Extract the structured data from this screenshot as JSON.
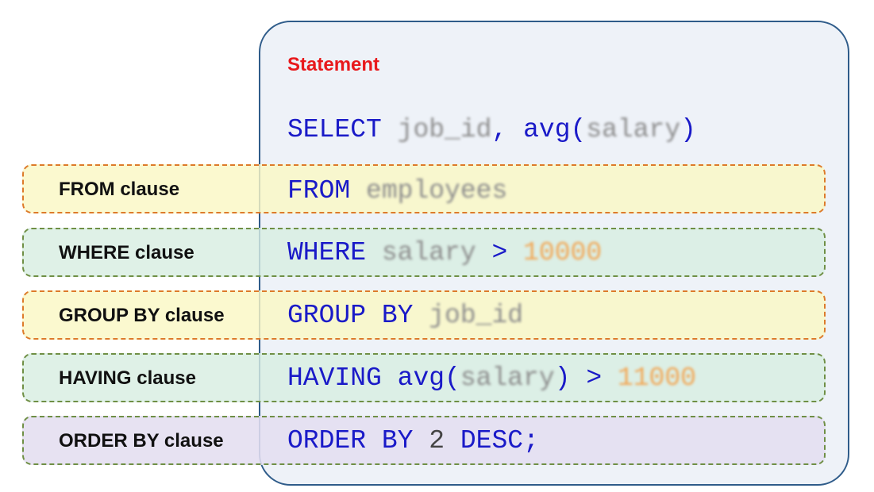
{
  "statement": {
    "title": "Statement"
  },
  "clauses": [
    {
      "label": "FROM clause",
      "color": "#f7f4c0",
      "border_color": "#dd7b2a"
    },
    {
      "label": "WHERE clause",
      "color": "#d8eee2",
      "border_color": "#6f8f45"
    },
    {
      "label": "GROUP BY clause",
      "color": "#f7f4c0",
      "border_color": "#dd7b2a"
    },
    {
      "label": "HAVING clause",
      "color": "#d8eee2",
      "border_color": "#6f8f45"
    },
    {
      "label": "ORDER BY clause",
      "color": "#e4def0",
      "border_color": "#6f8f45"
    }
  ],
  "code": {
    "select_kw": "SELECT",
    "select_col": "job_id",
    "select_comma": ",",
    "select_fn": "avg(",
    "select_arg": "salary",
    "select_close": ")",
    "from_kw": "FROM",
    "from_table": "employees",
    "where_kw": "WHERE",
    "where_col": "salary",
    "where_op": ">",
    "where_value": "10000",
    "group_kw": "GROUP BY",
    "group_col": "job_id",
    "having_kw": "HAVING",
    "having_fn": "avg(",
    "having_arg": "salary",
    "having_close": ")",
    "having_op": ">",
    "having_value": "11000",
    "order_kw": "ORDER BY",
    "order_num": "2",
    "order_dir": "DESC;"
  },
  "colors": {
    "keyword": "#1a1ac8",
    "title": "#e8191c",
    "panel_border": "#2f5c8a",
    "panel_fill": "#eef2f8"
  }
}
